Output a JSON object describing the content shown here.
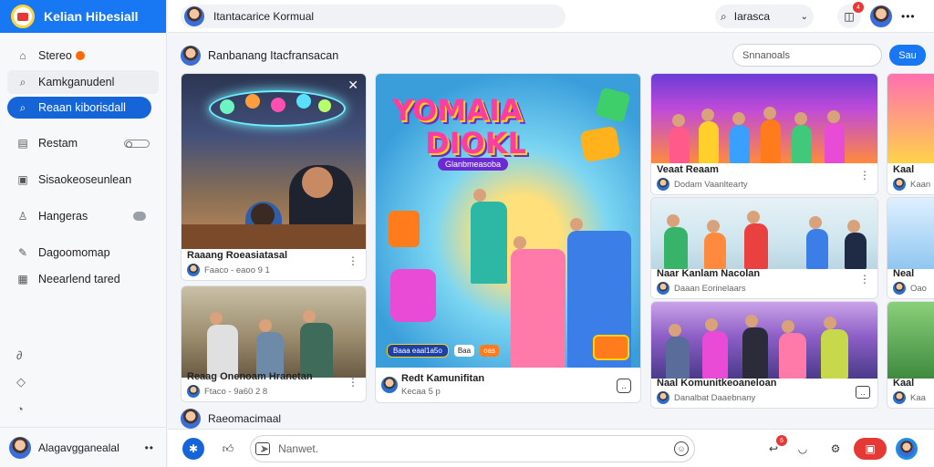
{
  "app": {
    "name": "Kelian Hibesiall"
  },
  "sidebar": {
    "items": [
      {
        "label": "Stereo",
        "icon": "home-icon"
      },
      {
        "label": "Kamkganudenl",
        "icon": "search-icon"
      },
      {
        "label": "Reaan kiborisdall",
        "icon": "search-icon",
        "active": true
      },
      {
        "label": "Restam",
        "icon": "bookmark-icon"
      },
      {
        "label": "Sisaokeoseunlean",
        "icon": "save-icon"
      },
      {
        "label": "Hangeras",
        "icon": "user-icon"
      },
      {
        "label": "Dagoomomap",
        "icon": "edit-icon"
      },
      {
        "label": "Neearlend tared",
        "icon": "list-icon"
      }
    ],
    "user_name": "Alagavgganealal"
  },
  "topbar": {
    "search_text": "Itantacarice Kormual",
    "search_label": "Iarasca",
    "notif_count": "4"
  },
  "feed": {
    "heading": "Ranbanang Itacfransacan",
    "announce_placeholder": "Snnanoals",
    "blue_button": "Sau",
    "bottom_heading": "Raeomacimaal"
  },
  "cards": {
    "c1": {
      "title": "Raaang Roeasiatasal",
      "sub": "Faaco - eaoo  9 1"
    },
    "c2": {
      "title": "Reaag Onenoam Hranetan",
      "sub": "Ftaco - 9a60 2 8"
    },
    "game": {
      "title_line1": "YOMAIA",
      "title_line2": "DIOKL",
      "tag": "Glanbmeasoba",
      "bar1": "Baaa eaal1a5o",
      "bar2": "Baa",
      "bar3": "oas",
      "title": "Redt Kamunifitan",
      "sub": "Kecaa 5 p"
    },
    "r1": {
      "title": "Veaat Reaam",
      "sub": "Dodam   Vaanltearty"
    },
    "r2": {
      "title": "Naar Kanlam Nacolan",
      "sub": "Daaan   Eorinelaars"
    },
    "r3": {
      "title": "Naal Komunitkeoaneloan",
      "sub": "Danalbat  Daaebnany"
    },
    "e1": {
      "title": "Kaal",
      "sub": "Kaan"
    },
    "e2": {
      "title": "Neal",
      "sub": "Oao"
    },
    "e3": {
      "title": "Kaal",
      "sub": "Kaa"
    }
  },
  "composer": {
    "placeholder": "Nanwet.",
    "badge_count": "6"
  }
}
